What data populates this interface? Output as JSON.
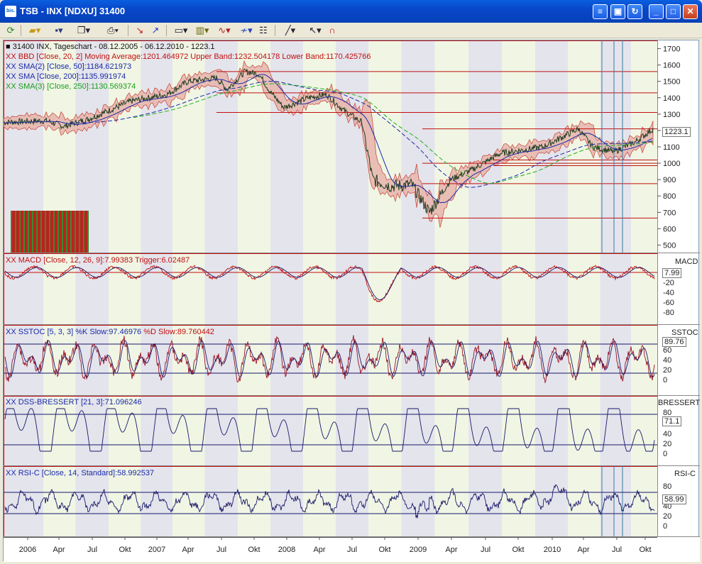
{
  "window": {
    "title": "TSB - INX [NDXU] 31400",
    "app_icon": "bis."
  },
  "toolbar": {
    "icons": [
      "refresh-icon",
      "open-folder-icon",
      "save-icon",
      "copy-icon",
      "print-icon",
      "chart-down-icon",
      "chart-up-icon",
      "chart-window-icon",
      "bar-chart-icon",
      "indicator-icon",
      "draw-tool-icon",
      "properties-icon",
      "line-tool-icon",
      "cursor-icon",
      "magnet-icon"
    ]
  },
  "main_panel": {
    "header": "31400 INX, Tageschart - 08.12.2005 - 06.12.2010 - 1223.1",
    "indicators": [
      {
        "text": "XX BBD [Close, 20, 2] Moving Average:1201.464972 Upper Band:1232.504178 Lower Band:1170.425766",
        "color": "#c01010"
      },
      {
        "text": "XX SMA(2) [Close, 50]:1184.621973",
        "color": "#1a2aa8"
      },
      {
        "text": "XX SMA [Close, 200]:1135.991974",
        "color": "#1a2aa8"
      },
      {
        "text": "XX SMA(3) [Close, 250]:1130.569374",
        "color": "#1aa01a"
      }
    ],
    "y_ticks": [
      "1700",
      "1600",
      "1500",
      "1400",
      "1300",
      "1200",
      "1100",
      "1000",
      "900",
      "800",
      "700",
      "600",
      "500"
    ],
    "current_value": "1223.1"
  },
  "macd_panel": {
    "name": "MACD",
    "legend": "XX MACD [Close, 12, 26, 9]:7.99383 Trigger:6.02487",
    "current": "7.99",
    "y_ticks": [
      "-20",
      "-40",
      "-60",
      "-80"
    ]
  },
  "sstoc_panel": {
    "name": "SSTOC",
    "legend_a": "XX SSTOC [5, 3, 3] %K Slow:97.46976",
    "legend_b": "%D Slow:89.760442",
    "current": "89.76",
    "y_ticks": [
      "60",
      "40",
      "20",
      "0"
    ]
  },
  "dss_panel": {
    "name": "BRESSERT",
    "legend": "XX DSS-BRESSERT [21, 3]:71.096246",
    "current": "71.1",
    "y_ticks": [
      "80",
      "40",
      "20",
      "0"
    ]
  },
  "rsi_panel": {
    "name": "RSI-C",
    "legend": "XX RSI-C [Close, 14, Standard]:58.992537",
    "current": "58.99",
    "y_ticks": [
      "80",
      "40",
      "20",
      "0"
    ]
  },
  "x_axis": {
    "labels": [
      "2006",
      "Apr",
      "Jul",
      "Okt",
      "2007",
      "Apr",
      "Jul",
      "Okt",
      "2008",
      "Apr",
      "Jul",
      "Okt",
      "2009",
      "Apr",
      "Jul",
      "Okt",
      "2010",
      "Apr",
      "Jul",
      "Okt"
    ]
  },
  "colors": {
    "band_fill": "#e8b8b0",
    "band_line": "#c03020",
    "sma50": "#1a2aa8",
    "sma200": "#1a2aa8",
    "sma250": "#22b022",
    "price": "#1e3a1e",
    "hline": "#c01010",
    "osc_line": "#18186a",
    "osc_red": "#c01010"
  }
}
